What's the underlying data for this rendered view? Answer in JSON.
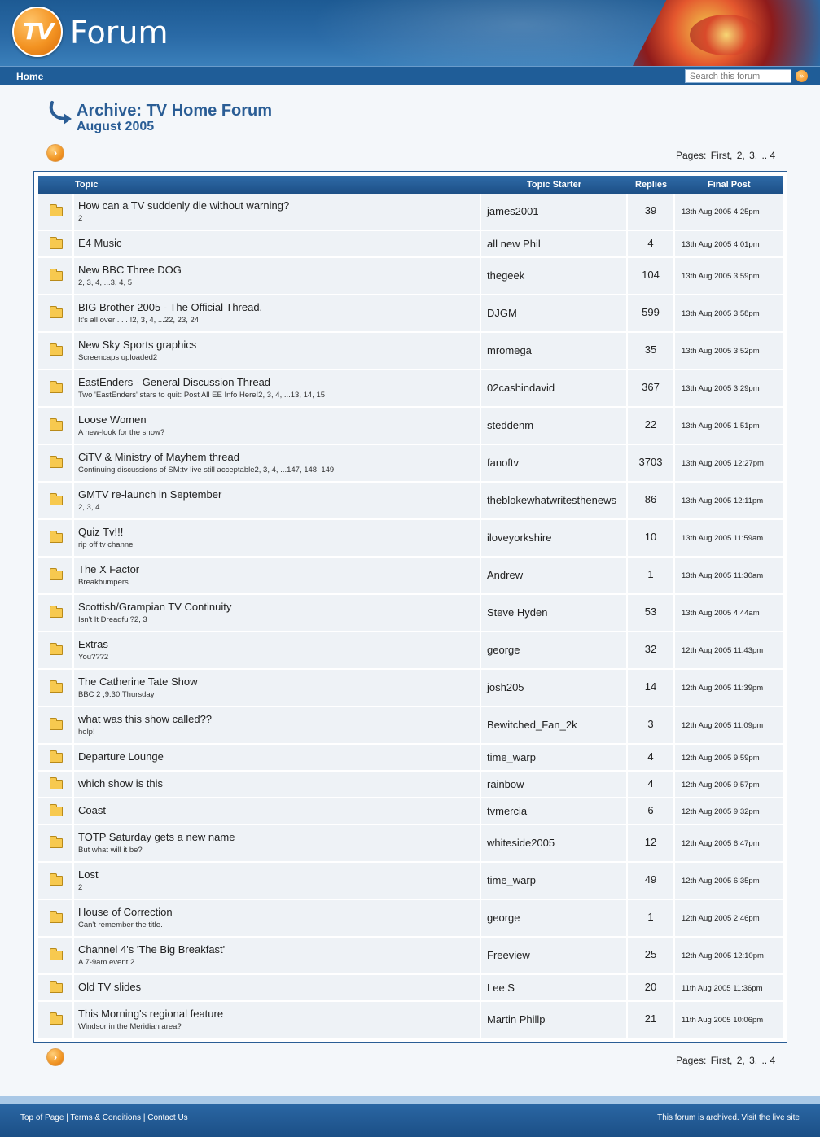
{
  "header": {
    "logo_text": "TV",
    "site_title": "Forum"
  },
  "nav": {
    "home": "Home",
    "search_placeholder": "Search this forum",
    "search_go": "»"
  },
  "archive": {
    "title": "Archive: TV Home Forum",
    "date": "August 2005"
  },
  "pagination": {
    "label": "Pages:",
    "items": [
      "First,",
      "2,",
      "3,",
      ".. 4"
    ]
  },
  "table": {
    "headers": {
      "topic": "Topic",
      "starter": "Topic Starter",
      "replies": "Replies",
      "final": "Final Post"
    },
    "rows": [
      {
        "title": "How can a TV suddenly die without warning?",
        "sub": "2",
        "starter": "james2001",
        "replies": "39",
        "final": "13th Aug 2005 4:25pm"
      },
      {
        "title": "E4 Music",
        "sub": "",
        "starter": "all new Phil",
        "replies": "4",
        "final": "13th Aug 2005 4:01pm"
      },
      {
        "title": "New BBC Three DOG",
        "sub": "2,  3,  4,  ...3,  4,  5",
        "starter": "thegeek",
        "replies": "104",
        "final": "13th Aug 2005 3:59pm"
      },
      {
        "title": "BIG Brother 2005 - The Official Thread.",
        "sub": "It's all over . . . !2,  3,  4,  ...22,  23,  24",
        "starter": "DJGM",
        "replies": "599",
        "final": "13th Aug 2005 3:58pm"
      },
      {
        "title": "New Sky Sports graphics",
        "sub": "Screencaps uploaded2",
        "starter": "mromega",
        "replies": "35",
        "final": "13th Aug 2005 3:52pm"
      },
      {
        "title": "EastEnders - General Discussion Thread",
        "sub": "Two 'EastEnders' stars to quit: Post All EE Info Here!2,  3,  4,  ...13,  14,  15",
        "starter": "02cashindavid",
        "replies": "367",
        "final": "13th Aug 2005 3:29pm"
      },
      {
        "title": "Loose Women",
        "sub": "A new-look for the show?",
        "starter": "steddenm",
        "replies": "22",
        "final": "13th Aug 2005 1:51pm"
      },
      {
        "title": "CiTV & Ministry of Mayhem thread",
        "sub": "Continuing discussions of SM:tv live still acceptable2,  3,  4,  ...147,  148,  149",
        "starter": "fanoftv",
        "replies": "3703",
        "final": "13th Aug 2005 12:27pm"
      },
      {
        "title": "GMTV re-launch in September",
        "sub": "2,  3,  4",
        "starter": "theblokewhatwritesthenews",
        "replies": "86",
        "final": "13th Aug 2005 12:11pm"
      },
      {
        "title": "Quiz Tv!!!",
        "sub": "rip off tv channel",
        "starter": "iloveyorkshire",
        "replies": "10",
        "final": "13th Aug 2005 11:59am"
      },
      {
        "title": "The X Factor",
        "sub": "Breakbumpers",
        "starter": "Andrew",
        "replies": "1",
        "final": "13th Aug 2005 11:30am"
      },
      {
        "title": "Scottish/Grampian TV Continuity",
        "sub": "Isn't It Dreadful?2,  3",
        "starter": "Steve Hyden",
        "replies": "53",
        "final": "13th Aug 2005 4:44am"
      },
      {
        "title": "Extras",
        "sub": "You???2",
        "starter": "george",
        "replies": "32",
        "final": "12th Aug 2005 11:43pm"
      },
      {
        "title": "The Catherine Tate Show",
        "sub": "BBC 2 ,9.30,Thursday",
        "starter": "josh205",
        "replies": "14",
        "final": "12th Aug 2005 11:39pm"
      },
      {
        "title": "what was this show called??",
        "sub": "help!",
        "starter": "Bewitched_Fan_2k",
        "replies": "3",
        "final": "12th Aug 2005 11:09pm"
      },
      {
        "title": "Departure Lounge",
        "sub": "",
        "starter": "time_warp",
        "replies": "4",
        "final": "12th Aug 2005 9:59pm"
      },
      {
        "title": "which show is this",
        "sub": "",
        "starter": "rainbow",
        "replies": "4",
        "final": "12th Aug 2005 9:57pm"
      },
      {
        "title": "Coast",
        "sub": "",
        "starter": "tvmercia",
        "replies": "6",
        "final": "12th Aug 2005 9:32pm"
      },
      {
        "title": "TOTP Saturday gets a new name",
        "sub": "But what will it be?",
        "starter": "whiteside2005",
        "replies": "12",
        "final": "12th Aug 2005 6:47pm"
      },
      {
        "title": "Lost",
        "sub": "2",
        "starter": "time_warp",
        "replies": "49",
        "final": "12th Aug 2005 6:35pm"
      },
      {
        "title": "House of Correction",
        "sub": "Can't remember the title.",
        "starter": "george",
        "replies": "1",
        "final": "12th Aug 2005 2:46pm"
      },
      {
        "title": "Channel 4's 'The Big Breakfast'",
        "sub": "A 7-9am event!2",
        "starter": "Freeview",
        "replies": "25",
        "final": "12th Aug 2005 12:10pm"
      },
      {
        "title": "Old TV slides",
        "sub": "",
        "starter": "Lee S",
        "replies": "20",
        "final": "11th Aug 2005 11:36pm"
      },
      {
        "title": "This Morning's regional feature",
        "sub": "Windsor in the Meridian area?",
        "starter": "Martin Phillp",
        "replies": "21",
        "final": "11th Aug 2005 10:06pm"
      }
    ]
  },
  "footer": {
    "top_of_page": "Top of Page",
    "terms": "Terms & Conditions",
    "contact": "Contact Us",
    "separator": " | ",
    "archived_note": "This forum is archived. Visit the live site"
  },
  "colors": {
    "brand_blue": "#1f5d98",
    "title_blue": "#2a5d95",
    "accent_orange": "#f29a2a",
    "row_bg": "#eef2f6"
  }
}
